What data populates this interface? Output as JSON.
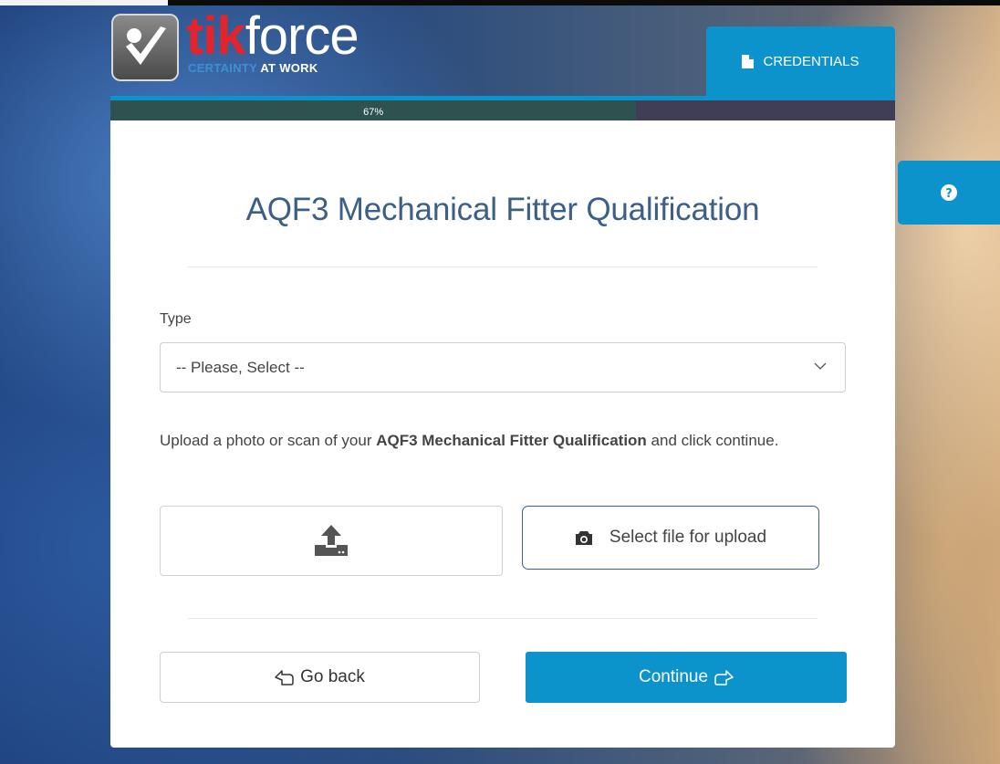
{
  "brand": {
    "name_part1": "tik",
    "name_part2": "force",
    "tagline_part1": "CERTAINTY ",
    "tagline_part2": "AT WORK"
  },
  "tabs": {
    "credentials_label": "CREDENTIALS"
  },
  "progress": {
    "percent": 67,
    "label": "67%"
  },
  "form": {
    "title": "AQF3 Mechanical Fitter Qualification",
    "type_label": "Type",
    "type_select_value": "-- Please, Select --",
    "upload_text_prefix": "Upload a photo or scan of your ",
    "upload_text_bold": "AQF3 Mechanical Fitter Qualification",
    "upload_text_suffix": " and click continue.",
    "select_file_label": "Select file for upload",
    "back_label": "Go back",
    "continue_label": "Continue"
  },
  "colors": {
    "accent": "#0c93cc",
    "title": "#3b5f86",
    "brand_red": "#e3242b",
    "progress_fill": "#2d5250",
    "progress_track": "#3f3e56"
  },
  "icons": {
    "logo": "checkmark-logo-icon",
    "credentials": "document-icon",
    "help": "question-circle-icon",
    "dropdown": "chevron-down-icon",
    "upload": "upload-tray-icon",
    "camera": "camera-icon",
    "back": "hand-point-left-icon",
    "continue": "hand-point-right-icon"
  }
}
